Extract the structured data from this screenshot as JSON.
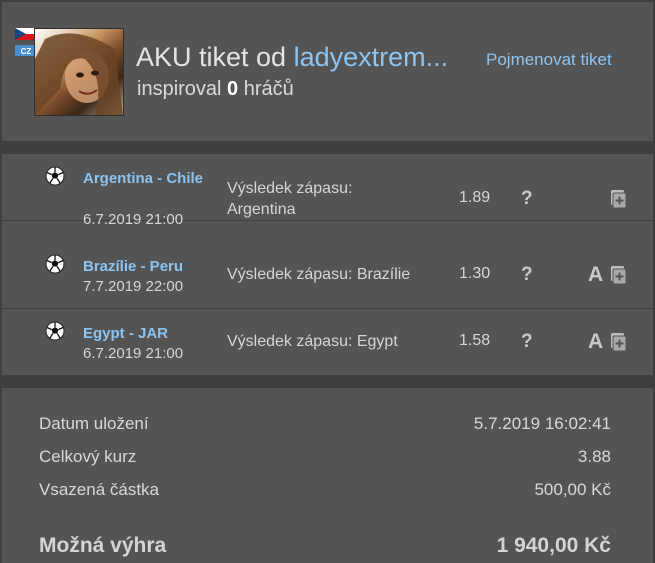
{
  "header": {
    "flag_label": "CZ",
    "title_prefix": "AKU tiket od",
    "username": "ladyextrem...",
    "inspired_prefix": "inspiroval",
    "inspired_count": "0",
    "inspired_suffix": "hráčů",
    "rename_label": "Pojmenovat tiket"
  },
  "matches": [
    {
      "teams": "Argentina - Chile",
      "datetime": "6.7.2019 21:00",
      "bet": "Výsledek zápasu: Argentina",
      "odds": "1.89",
      "status": "?",
      "has_a": false
    },
    {
      "teams": "Brazílie - Peru",
      "datetime": "7.7.2019 22:00",
      "bet": "Výsledek zápasu: Brazílie",
      "odds": "1.30",
      "status": "?",
      "has_a": true,
      "a_label": "A"
    },
    {
      "teams": "Egypt - JAR",
      "datetime": "6.7.2019 21:00",
      "bet": "Výsledek zápasu: Egypt",
      "odds": "1.58",
      "status": "?",
      "has_a": true,
      "a_label": "A"
    }
  ],
  "summary": {
    "saved_label": "Datum uložení",
    "saved_value": "5.7.2019 16:02:41",
    "total_odds_label": "Celkový kurz",
    "total_odds_value": "3.88",
    "stake_label": "Vsazená částka",
    "stake_value": "500,00 Kč",
    "win_label": "Možná výhra",
    "win_value": "1 940,00 Kč"
  },
  "colors": {
    "link": "#8cc4f2",
    "panel": "#545454",
    "background": "#3f3f3f"
  }
}
